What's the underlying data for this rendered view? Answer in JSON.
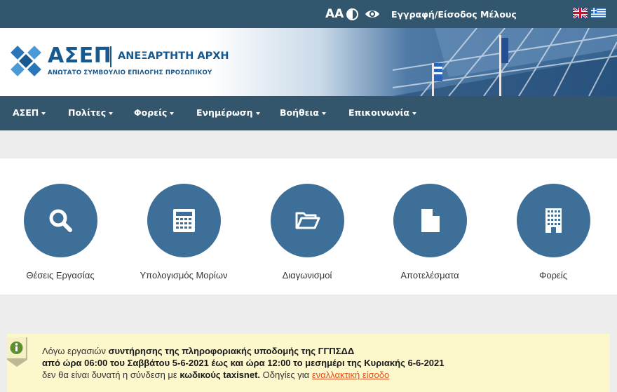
{
  "topbar": {
    "font_size_toggle": "AA",
    "contrast_icon": "contrast-icon",
    "visibility_icon": "eye-icon",
    "login_label": "Εγγραφή/Είσοδος Μέλους",
    "languages": [
      "english-flag",
      "greek-flag"
    ]
  },
  "header": {
    "logo_name": "ΑΣΕΠ",
    "logo_subtitle": "ΑΝΕΞΑΡΤΗΤΗ ΑΡΧΗ",
    "logo_tagline": "ΑΝΩΤΑΤΟ ΣΥΜΒΟΥΛΙΟ ΕΠΙΛΟΓΗΣ ΠΡΟΣΩΠΙΚΟΥ"
  },
  "nav": {
    "items": [
      {
        "label": "ΑΣΕΠ"
      },
      {
        "label": "Πολίτες"
      },
      {
        "label": "Φορείς"
      },
      {
        "label": "Ενημέρωση"
      },
      {
        "label": "Βοήθεια"
      },
      {
        "label": "Επικοινωνία"
      }
    ]
  },
  "shortcuts": [
    {
      "label": "Θέσεις Εργασίας",
      "icon": "search-icon"
    },
    {
      "label": "Υπολογισμός Μορίων",
      "icon": "calculator-icon"
    },
    {
      "label": "Διαγωνισμοί",
      "icon": "folder-open-icon"
    },
    {
      "label": "Αποτελέσματα",
      "icon": "document-icon"
    },
    {
      "label": "Φορείς",
      "icon": "building-icon"
    }
  ],
  "notice": {
    "icon": "info-icon",
    "line1_pre": "Λόγω εργασιών ",
    "line1_bold": "συντήρησης της πληροφοριακής υποδομής της ΓΓΠΣΔΔ",
    "line2_bold": "από ώρα 06:00 του Σαββάτου 5-6-2021 έως και ώρα 12:00 το μεσημέρι της Κυριακής 6-6-2021",
    "line3_pre": "δεν θα είναι δυνατή η σύνδεση με ",
    "line3_bold": "κωδικούς taxisnet.",
    "line3_mid": " Οδηγίες για ",
    "line3_link": "εναλλακτική είσοδο"
  },
  "colors": {
    "topbar": "#31566d",
    "nav": "#33566c",
    "brand_blue": "#17588e",
    "shortcut_circle": "#3d6f98",
    "notice_bg": "#fdf7cc",
    "notice_badge": "#5e8f2e",
    "link": "#e0501f"
  }
}
